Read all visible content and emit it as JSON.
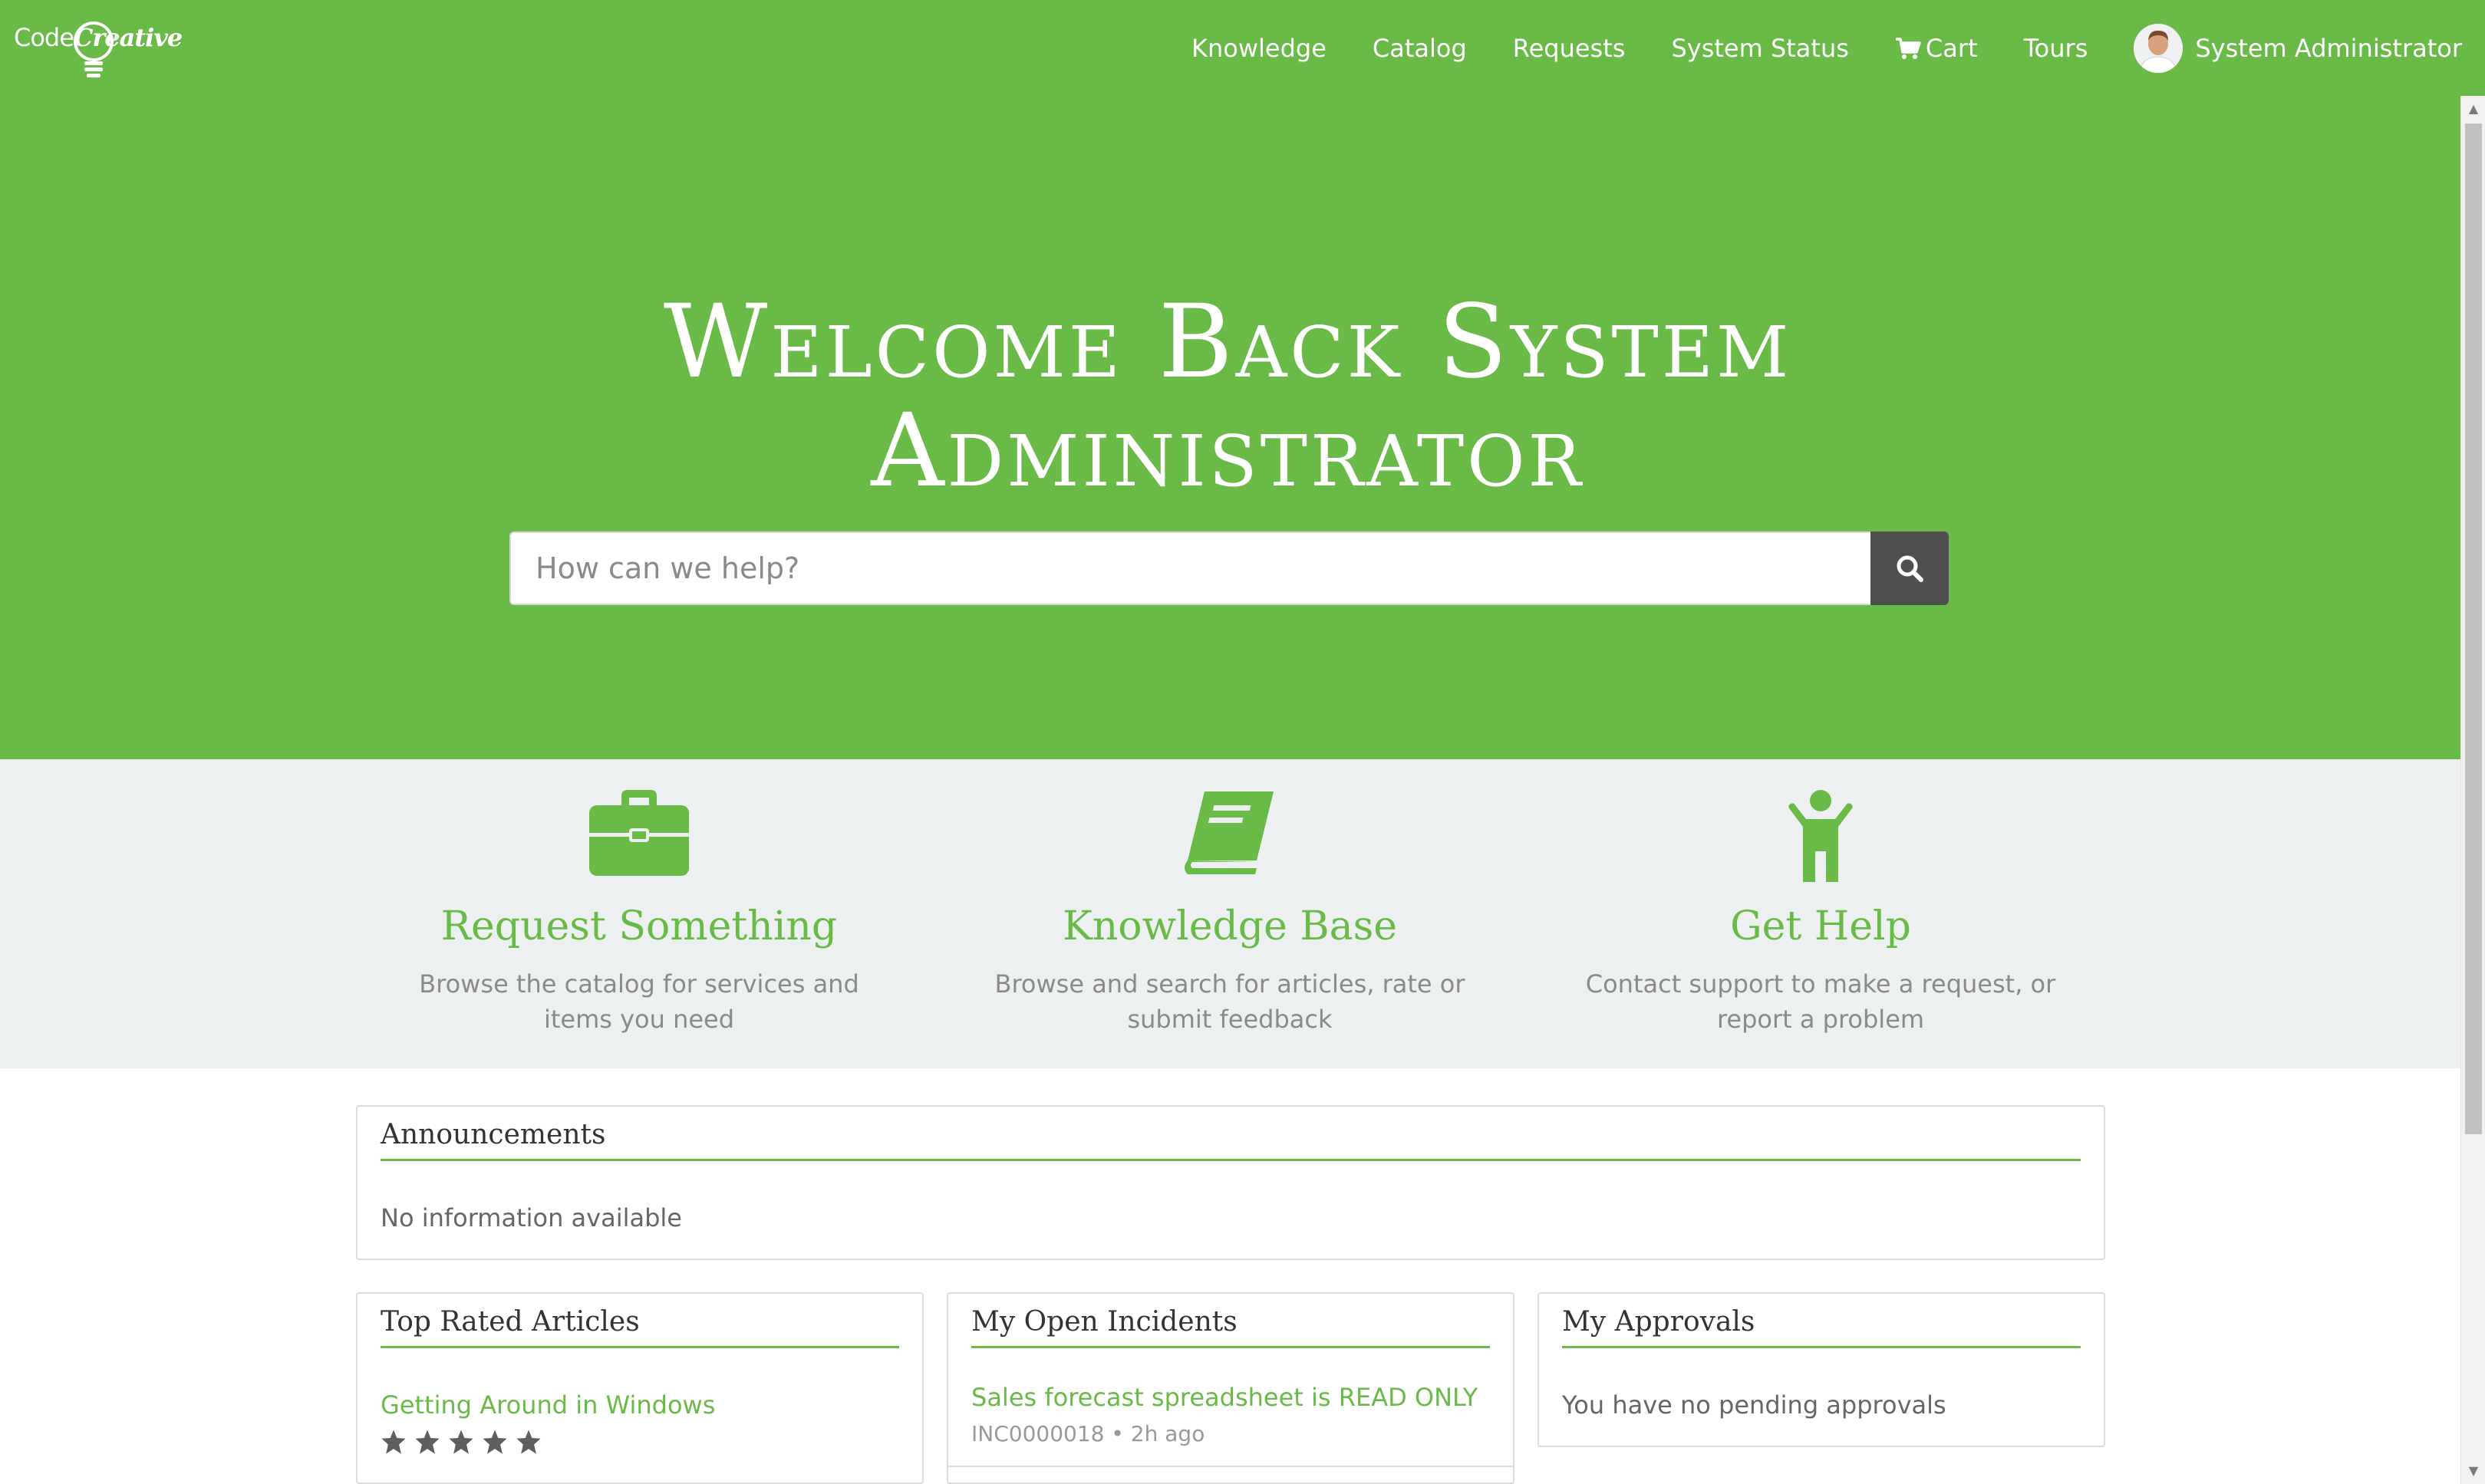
{
  "brand": {
    "logo_plain": "Code",
    "logo_bold": "Creative"
  },
  "nav": {
    "items": [
      "Knowledge",
      "Catalog",
      "Requests",
      "System Status"
    ],
    "cart_label": "Cart",
    "tours_label": "Tours",
    "user_name": "System Administrator"
  },
  "hero": {
    "title_line1": "Welcome Back System",
    "title_line2": "Administrator",
    "search_placeholder": "How can we help?"
  },
  "features": [
    {
      "icon": "briefcase-icon",
      "title": "Request Something",
      "desc": "Browse the catalog for services and items you need"
    },
    {
      "icon": "book-icon",
      "title": "Knowledge Base",
      "desc": "Browse and search for articles, rate or submit feedback"
    },
    {
      "icon": "person-icon",
      "title": "Get Help",
      "desc": "Contact support to make a request, or report a problem"
    }
  ],
  "announcements": {
    "title": "Announcements",
    "empty_text": "No information available"
  },
  "top_rated": {
    "title": "Top Rated Articles",
    "articles": [
      {
        "title": "Getting Around in Windows",
        "rating": 5
      }
    ]
  },
  "open_incidents": {
    "title": "My Open Incidents",
    "items": [
      {
        "title": "Sales forecast spreadsheet is READ ONLY",
        "number": "INC0000018",
        "age": "2h ago"
      }
    ]
  },
  "approvals": {
    "title": "My Approvals",
    "empty_text": "You have no pending approvals"
  },
  "colors": {
    "brand_green": "#6aba47",
    "band_gray": "#edf0f0",
    "search_button": "#4f4f4f"
  }
}
